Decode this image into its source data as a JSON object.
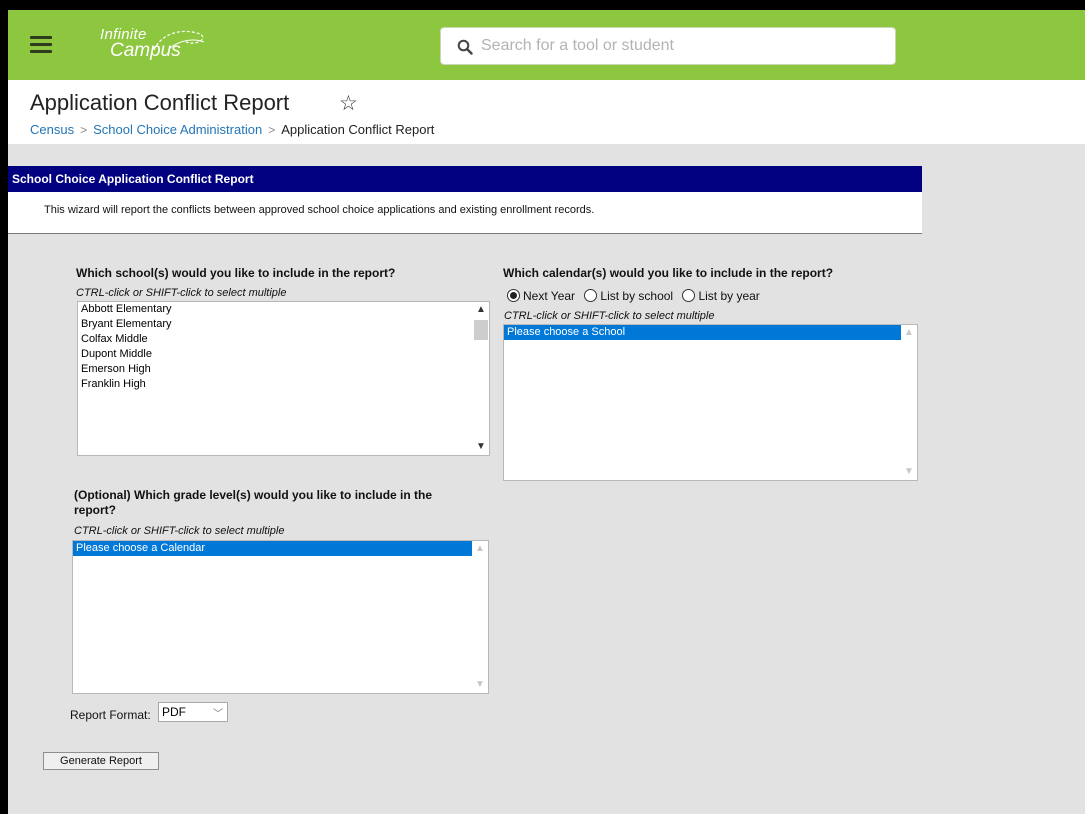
{
  "header": {
    "logo_line1": "Infinite",
    "logo_line2": "Campus",
    "search_placeholder": "Search for a tool or student"
  },
  "page": {
    "title": "Application Conflict Report",
    "breadcrumb": [
      "Census",
      "School Choice Administration",
      "Application Conflict Report"
    ]
  },
  "report": {
    "header": "School Choice Application Conflict Report",
    "description": "This wizard will report the conflicts between approved school choice applications and existing enrollment records.",
    "schools_question": "Which school(s) would you like to include in the report?",
    "schools_hint": "CTRL-click or SHIFT-click to select multiple",
    "schools": [
      "Abbott Elementary",
      "Bryant Elementary",
      "Colfax Middle",
      "Dupont Middle",
      "Emerson High",
      "Franklin High"
    ],
    "calendars_question": "Which calendar(s) would you like to include in the report?",
    "calendar_options": [
      "Next Year",
      "List by school",
      "List by year"
    ],
    "calendar_selected": "Next Year",
    "calendars_hint": "CTRL-click or SHIFT-click to select multiple",
    "calendars_list": [
      "Please choose a School"
    ],
    "grades_question_line1": "(Optional) Which grade level(s) would you like to include in the",
    "grades_question_line2": "report?",
    "grades_hint": "CTRL-click or SHIFT-click to select multiple",
    "grades_list": [
      "Please choose a Calendar"
    ],
    "format_label": "Report Format:",
    "format_value": "PDF",
    "generate_label": "Generate Report"
  },
  "colors": {
    "topbar": "#8dc63f",
    "panel_header": "#000080",
    "link": "#2275b7",
    "selection": "#0078d7"
  }
}
